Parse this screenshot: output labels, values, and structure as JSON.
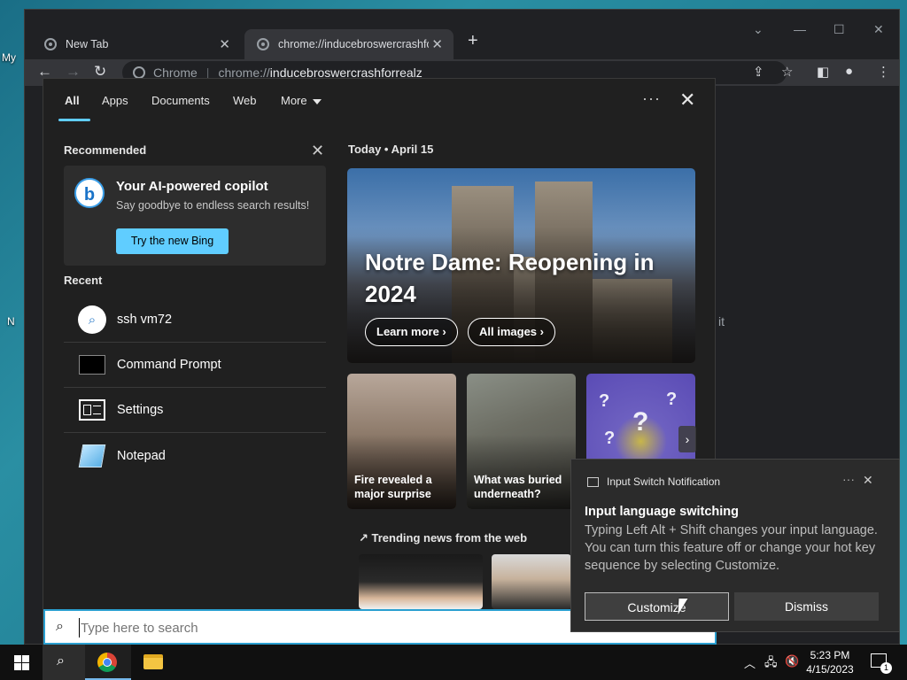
{
  "desktop": {
    "labels": [
      "My",
      "N"
    ]
  },
  "chrome": {
    "tabs": [
      {
        "title": "New Tab"
      },
      {
        "title": "chrome://inducebroswercrashforrealz"
      }
    ],
    "new_tab_symbol": "+",
    "address": {
      "chip": "Chrome",
      "scheme": "chrome://",
      "host": "inducebroswercrashforrealz"
    },
    "background_text": "it"
  },
  "search_panel": {
    "tabs": [
      "All",
      "Apps",
      "Documents",
      "Web",
      "More"
    ],
    "recommended_title": "Recommended",
    "copilot": {
      "logo": "b",
      "title": "Your AI-powered copilot",
      "subtitle": "Say goodbye to endless search results!",
      "button": "Try the new Bing"
    },
    "recent_title": "Recent",
    "recent": [
      {
        "label": "ssh vm72",
        "icon": "search-icon"
      },
      {
        "label": "Command Prompt",
        "icon": "command-prompt-icon"
      },
      {
        "label": "Settings",
        "icon": "settings-icon"
      },
      {
        "label": "Notepad",
        "icon": "notepad-icon"
      }
    ],
    "today_label": "Today  •  April 15",
    "hero": {
      "title": "Notre Dame: Reopening in 2024",
      "buttons": [
        "Learn more ›",
        "All images ›"
      ]
    },
    "cards": [
      {
        "title": "Fire revealed a major surprise"
      },
      {
        "title": "What was buried underneath?"
      }
    ],
    "trending_title": "Trending news from the web",
    "search_box": {
      "placeholder": "Type here to search"
    }
  },
  "notification": {
    "app": "Input Switch Notification",
    "title": "Input language switching",
    "body": "Typing Left Alt + Shift changes your input language. You can turn this feature off or change your hot key sequence by selecting Customize.",
    "buttons": {
      "customize": "Customize",
      "dismiss": "Dismiss"
    }
  },
  "taskbar": {
    "time": "5:23 PM",
    "date": "4/15/2023",
    "notification_count": "1"
  }
}
